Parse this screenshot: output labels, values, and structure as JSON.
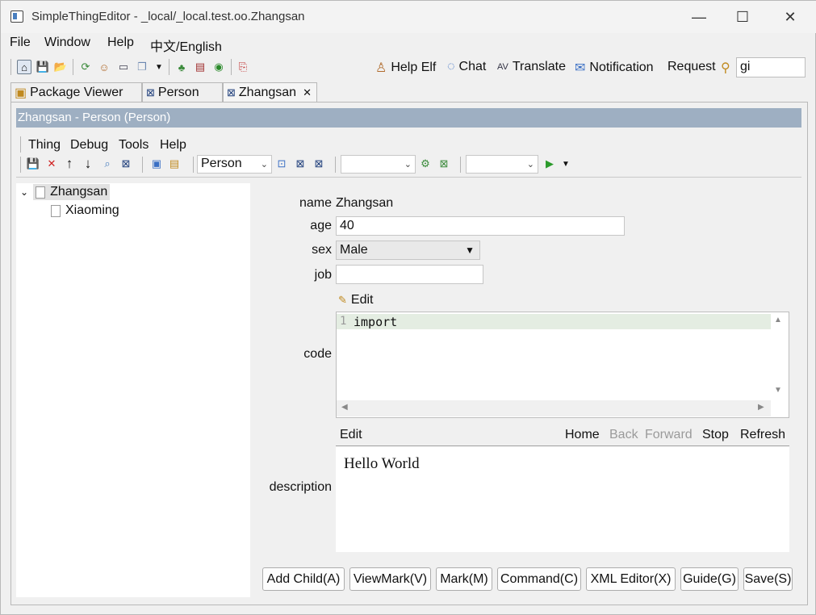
{
  "window": {
    "title": "SimpleThingEditor - _local/_local.test.oo.Zhangsan",
    "minimize": "—",
    "maximize": "☐",
    "close": "✕"
  },
  "menubar": [
    "File",
    "Window",
    "Help",
    "中文/English"
  ],
  "toolbar": {
    "help_elf": "Help Elf",
    "chat": "Chat",
    "translate": "Translate",
    "notification": "Notification",
    "request": "Request",
    "search_value": "gi"
  },
  "tabs": [
    {
      "label": "Package Viewer"
    },
    {
      "label": "Person"
    },
    {
      "label": "Zhangsan",
      "active": true
    }
  ],
  "editor": {
    "header": "Zhangsan - Person  (Person)",
    "menus": [
      "Thing",
      "Debug",
      "Tools",
      "Help"
    ],
    "type_combo": "Person"
  },
  "tree": {
    "root": "Zhangsan",
    "children": [
      "Xiaoming"
    ]
  },
  "form": {
    "name_label": "name",
    "name_value": "Zhangsan",
    "age_label": "age",
    "age_value": "40",
    "sex_label": "sex",
    "sex_value": "Male",
    "job_label": "job",
    "job_value": "",
    "code_label": "code",
    "code_edit": "Edit",
    "code_line_no": "1",
    "code_text": "import",
    "description_label": "description",
    "desc_edit": "Edit",
    "desc_nav": {
      "home": "Home",
      "back": "Back",
      "forward": "Forward",
      "stop": "Stop",
      "refresh": "Refresh"
    },
    "description_text": "Hello World"
  },
  "buttons": [
    "Add Child(A)",
    "ViewMark(V)",
    "Mark(M)",
    "Command(C)",
    "XML Editor(X)",
    "Guide(G)",
    "Save(S)"
  ]
}
